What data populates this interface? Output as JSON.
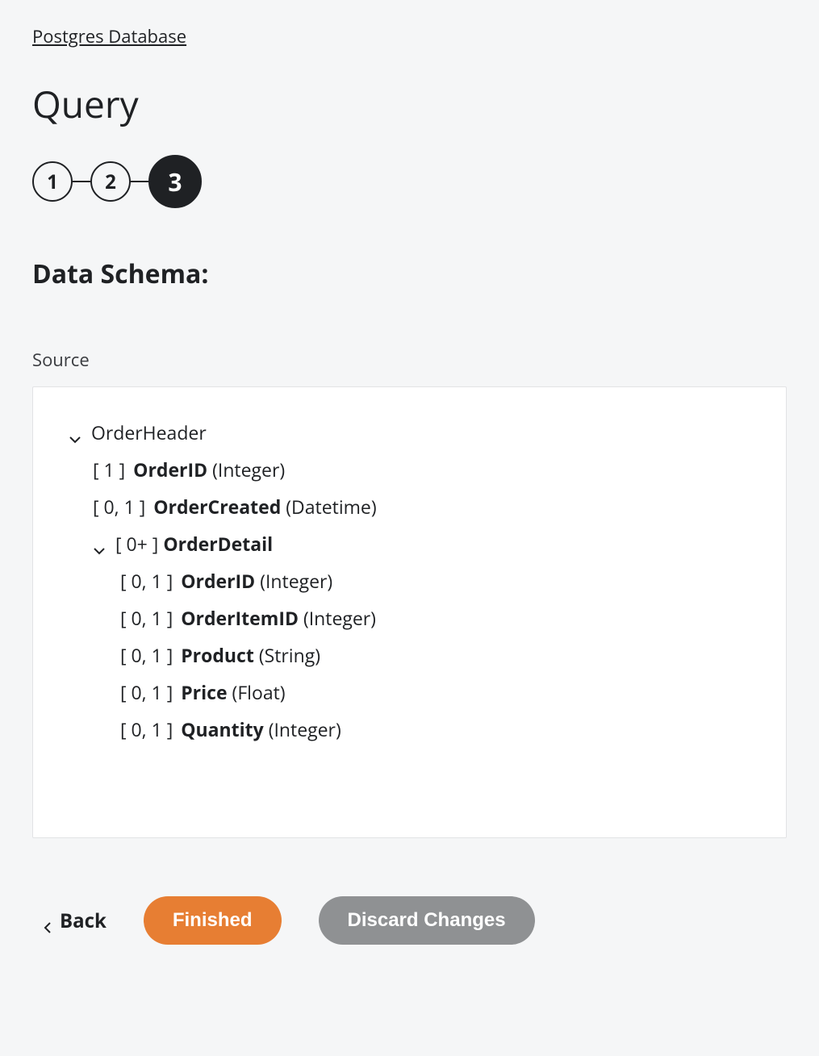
{
  "breadcrumb": "Postgres Database",
  "page_title": "Query",
  "stepper": {
    "steps": [
      "1",
      "2",
      "3"
    ],
    "active_index": 2
  },
  "section_heading": "Data Schema:",
  "source_label": "Source",
  "schema": {
    "root": {
      "name": "OrderHeader",
      "fields": [
        {
          "card": "[ 1 ]",
          "name": "OrderID",
          "type": "(Integer)"
        },
        {
          "card": "[ 0, 1 ]",
          "name": "OrderCreated",
          "type": "(Datetime)"
        }
      ],
      "child": {
        "card": "[ 0+ ]",
        "name": "OrderDetail",
        "fields": [
          {
            "card": "[ 0, 1 ]",
            "name": "OrderID",
            "type": "(Integer)"
          },
          {
            "card": "[ 0, 1 ]",
            "name": "OrderItemID",
            "type": "(Integer)"
          },
          {
            "card": "[ 0, 1 ]",
            "name": "Product",
            "type": "(String)"
          },
          {
            "card": "[ 0, 1 ]",
            "name": "Price",
            "type": "(Float)"
          },
          {
            "card": "[ 0, 1 ]",
            "name": "Quantity",
            "type": "(Integer)"
          }
        ]
      }
    }
  },
  "footer": {
    "back": "Back",
    "finished": "Finished",
    "discard": "Discard Changes"
  }
}
